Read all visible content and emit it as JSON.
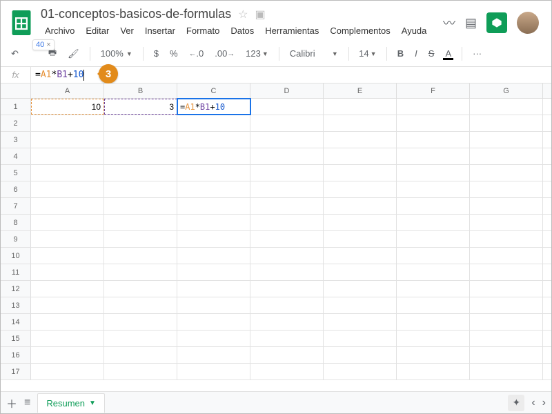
{
  "doc": {
    "title": "01-conceptos-basicos-de-formulas"
  },
  "menus": [
    "Archivo",
    "Editar",
    "Ver",
    "Insertar",
    "Formato",
    "Datos",
    "Herramientas",
    "Complementos",
    "Ayuda"
  ],
  "toolbar": {
    "zoom": "100%",
    "currency": "$",
    "percent": "%",
    "dec_dec": ".0",
    "inc_dec": ".00",
    "num_fmt": "123",
    "font": "Calibri",
    "font_size": "14",
    "more": "···"
  },
  "preview": {
    "value": "40",
    "close": "×"
  },
  "formula_bar": {
    "fx": "fx",
    "eq": "=",
    "ref1": "A1",
    "op1": "*",
    "ref2": "B1",
    "op2": "+",
    "lit": "10"
  },
  "step": {
    "number": "3"
  },
  "columns": [
    "A",
    "B",
    "C",
    "D",
    "E",
    "F",
    "G"
  ],
  "rows": [
    "1",
    "2",
    "3",
    "4",
    "5",
    "6",
    "7",
    "8",
    "9",
    "10",
    "11",
    "12",
    "13",
    "14",
    "15",
    "16",
    "17"
  ],
  "cells": {
    "A1": "10",
    "B1": "3"
  },
  "active_cell_formula": {
    "eq": "=",
    "ref1": "A1",
    "op1": "*",
    "ref2": "B1",
    "op2": "+",
    "lit": "10"
  },
  "sheet": {
    "name": "Resumen",
    "caret": "▼",
    "left": "‹",
    "right": "›"
  }
}
